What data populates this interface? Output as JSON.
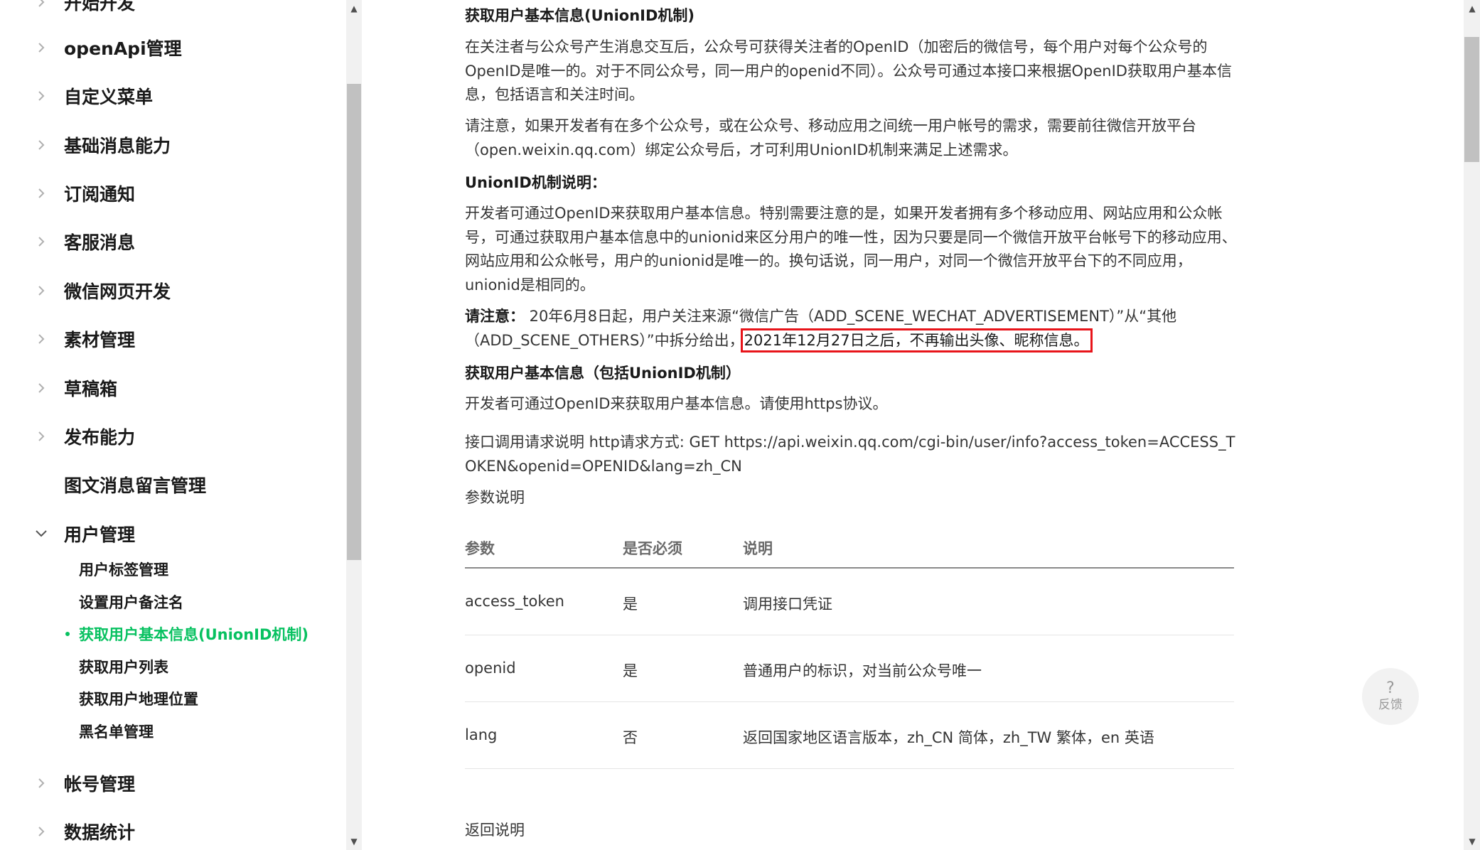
{
  "sidebar": {
    "top_partial": "开始开发",
    "items": [
      {
        "label": "openApi管理"
      },
      {
        "label": "自定义菜单"
      },
      {
        "label": "基础消息能力"
      },
      {
        "label": "订阅通知"
      },
      {
        "label": "客服消息"
      },
      {
        "label": "微信网页开发"
      },
      {
        "label": "素材管理"
      },
      {
        "label": "草稿箱"
      },
      {
        "label": "发布能力"
      },
      {
        "label": "图文消息留言管理"
      },
      {
        "label": "用户管理"
      },
      {
        "label": "帐号管理"
      },
      {
        "label": "数据统计"
      }
    ],
    "sub_items": [
      {
        "label": "用户标签管理"
      },
      {
        "label": "设置用户备注名"
      },
      {
        "label": "获取用户基本信息(UnionID机制)",
        "active": true
      },
      {
        "label": "获取用户列表"
      },
      {
        "label": "获取用户地理位置"
      },
      {
        "label": "黑名单管理"
      }
    ]
  },
  "content": {
    "title": "获取用户基本信息(UnionID机制)",
    "para1": "在关注者与公众号产生消息交互后，公众号可获得关注者的OpenID（加密后的微信号，每个用户对每个公众号的OpenID是唯一的。对于不同公众号，同一用户的openid不同）。公众号可通过本接口来根据OpenID获取用户基本信息，包括语言和关注时间。",
    "para2": "请注意，如果开发者有在多个公众号，或在公众号、移动应用之间统一用户帐号的需求，需要前往微信开放平台（open.weixin.qq.com）绑定公众号后，才可利用UnionID机制来满足上述需求。",
    "unionid_heading": "UnionID机制说明：",
    "para3": "开发者可通过OpenID来获取用户基本信息。特别需要注意的是，如果开发者拥有多个移动应用、网站应用和公众帐号，可通过获取用户基本信息中的unionid来区分用户的唯一性，因为只要是同一个微信开放平台帐号下的移动应用、网站应用和公众帐号，用户的unionid是唯一的。换句话说，同一用户，对同一个微信开放平台下的不同应用，unionid是相同的。",
    "notice_label": "请注意：",
    "notice_text": " 20年6月8日起，用户关注来源“微信广告（ADD_SCENE_WECHAT_ADVERTISEMENT）”从“其他（ADD_SCENE_OTHERS）”中拆分给出，",
    "notice_highlight": "2021年12月27日之后，不再输出头像、昵称信息。",
    "heading2": "获取用户基本信息（包括UnionID机制）",
    "para4": "开发者可通过OpenID来获取用户基本信息。请使用https协议。",
    "api_desc": "接口调用请求说明 http请求方式: GET https://api.weixin.qq.com/cgi-bin/user/info?access_token=ACCESS_TOKEN&openid=OPENID&lang=zh_CN",
    "param_label": "参数说明",
    "table": {
      "headers": [
        "参数",
        "是否必须",
        "说明"
      ],
      "rows": [
        [
          "access_token",
          "是",
          "调用接口凭证"
        ],
        [
          "openid",
          "是",
          "普通用户的标识，对当前公众号唯一"
        ],
        [
          "lang",
          "否",
          "返回国家地区语言版本，zh_CN 简体，zh_TW 繁体，en 英语"
        ]
      ]
    },
    "return_label": "返回说明"
  },
  "feedback": {
    "icon": "?",
    "label": "反馈"
  },
  "colors": {
    "accent": "#07c160",
    "highlight_border": "#e8141a"
  }
}
